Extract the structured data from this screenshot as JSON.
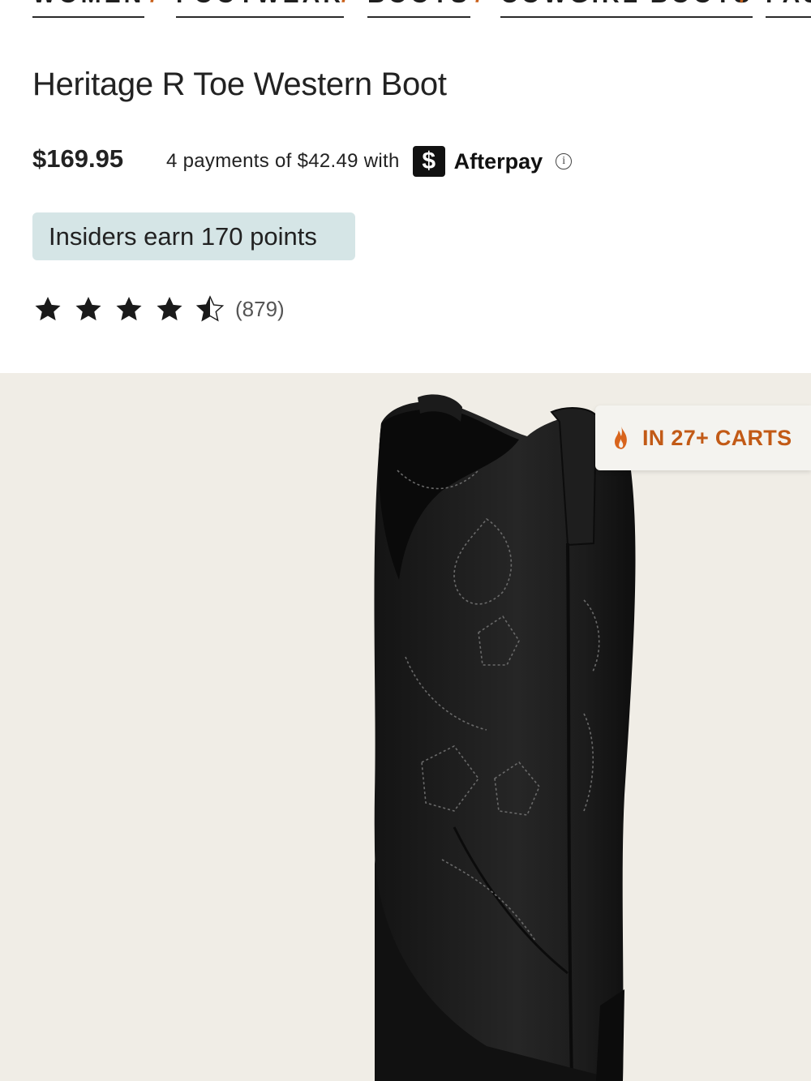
{
  "breadcrumb": {
    "items": [
      "WOMEN",
      "FOOTWEAR",
      "BOOTS",
      "COWGIRL BOOTS",
      "FAS"
    ],
    "separator": "/"
  },
  "product": {
    "title": "Heritage R Toe Western Boot",
    "price": "$169.95",
    "afterpay_text": "4 payments of $42.49 with",
    "afterpay_icon_glyph": "$",
    "afterpay_brand": "Afterpay",
    "info_glyph": "i",
    "insiders_text": "Insiders earn 170 points",
    "rating_value": 4.5,
    "rating_max": 5,
    "review_count": "(879)",
    "carts_badge": "IN 27+ CARTS"
  },
  "colors": {
    "accent_orange": "#c9601a",
    "insiders_bg": "#d5e5e6",
    "gallery_bg": "#f0ede6",
    "afterpay_black": "#111111"
  },
  "icons": {
    "star": "star-icon",
    "half_star": "half-star-icon",
    "flame": "flame-icon",
    "info": "info-icon",
    "afterpay": "afterpay-logo-icon"
  }
}
